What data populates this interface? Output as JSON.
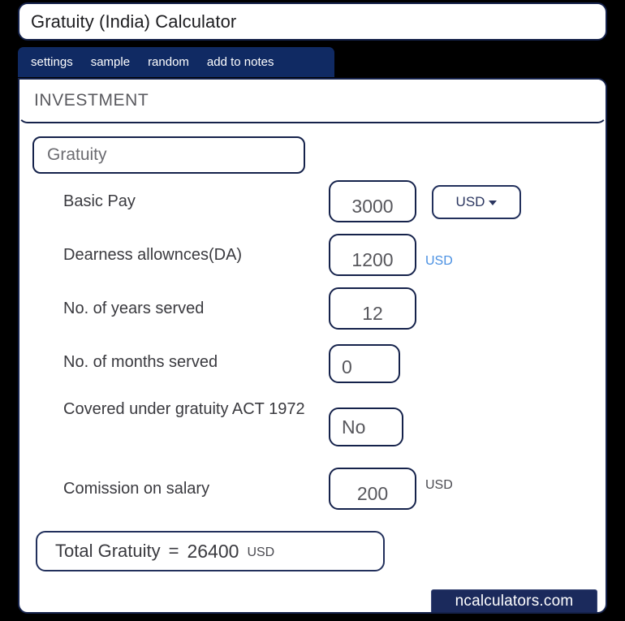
{
  "window": {
    "title": "Gratuity (India) Calculator"
  },
  "nav": {
    "items": [
      {
        "label": "settings",
        "name": "settings"
      },
      {
        "label": "sample",
        "name": "sample"
      },
      {
        "label": "random",
        "name": "random"
      },
      {
        "label": "add to notes",
        "name": "add-to-notes"
      }
    ]
  },
  "section": {
    "title": "INVESTMENT"
  },
  "calculator": {
    "name": "Gratuity"
  },
  "currency": {
    "selected": "USD",
    "caret_icon": "chevron-down-icon"
  },
  "form": {
    "rows": [
      {
        "label": "Basic Pay",
        "value": "3000",
        "unit": "",
        "unit_color": ""
      },
      {
        "label": "Dearness allownces(DA)",
        "value": "1200",
        "unit": "USD",
        "unit_color": "#4a90e2"
      },
      {
        "label": "No. of years served",
        "value": "12",
        "unit": "",
        "unit_color": ""
      },
      {
        "label": "No. of months served",
        "value": "0",
        "unit": "",
        "unit_color": ""
      },
      {
        "label": "Covered under gratuity ACT 1972",
        "value": "No",
        "unit": "",
        "unit_color": ""
      },
      {
        "label": "Comission on salary",
        "value": "200",
        "unit": "USD",
        "unit_color": "#4a4a50"
      }
    ]
  },
  "total": {
    "label": "Total Gratuity",
    "equals": "=",
    "value": "26400",
    "unit": "USD"
  },
  "footer": {
    "brand": "ncalculators.com"
  },
  "colors": {
    "page_background": "#000000",
    "card_background": "#ffffff",
    "navy_border": "#15224b",
    "navbar_background": "#102a63",
    "badge_background": "#1b2a5c",
    "accent_blue": "#4a90e2"
  }
}
